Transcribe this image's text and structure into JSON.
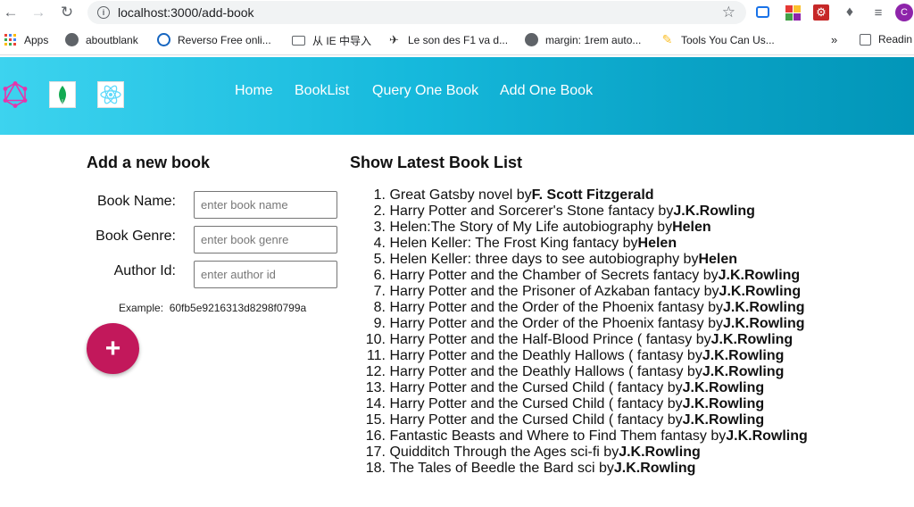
{
  "browser": {
    "url": "localhost:3000/add-book",
    "bookmarks": [
      {
        "label": "Apps"
      },
      {
        "label": "aboutblank"
      },
      {
        "label": "Reverso  Free onli..."
      },
      {
        "label": "从 IE 中导入"
      },
      {
        "label": "Le son des F1 va d..."
      },
      {
        "label": "margin: 1rem auto..."
      },
      {
        "label": "Tools You Can Us..."
      },
      {
        "label": "»"
      },
      {
        "label": "Readin"
      }
    ],
    "profile_initial": "C"
  },
  "nav": {
    "links": [
      "Home",
      "BookList",
      "Query One Book",
      "Add One Book"
    ]
  },
  "form": {
    "title": "Add a new book",
    "fields": [
      {
        "label": "Book Name:",
        "placeholder": "enter book name",
        "value": ""
      },
      {
        "label": "Book Genre:",
        "placeholder": "enter book genre",
        "value": ""
      },
      {
        "label": "Author Id:",
        "placeholder": "enter author id",
        "value": ""
      }
    ],
    "example_label": "Example:",
    "example_value": "60fb5e9216313d8298f0799a",
    "add_button": "+"
  },
  "book_list": {
    "title": "Show Latest Book List",
    "books": [
      {
        "n": "1.",
        "text": "Great Gatsby novel by ",
        "author": "F. Scott Fitzgerald"
      },
      {
        "n": "2.",
        "text": "Harry Potter and Sorcerer's Stone fantacy by ",
        "author": "J.K.Rowling"
      },
      {
        "n": "3.",
        "text": "Helen:The Story of My Life autobiography by ",
        "author": "Helen"
      },
      {
        "n": "4.",
        "text": "Helen Keller: The Frost King fantacy by ",
        "author": "Helen"
      },
      {
        "n": "5.",
        "text": "Helen Keller: three days to see autobiography by ",
        "author": "Helen"
      },
      {
        "n": "6.",
        "text": "Harry Potter and the Chamber of Secrets fantacy by ",
        "author": "J.K.Rowling"
      },
      {
        "n": "7.",
        "text": "Harry Potter and the Prisoner of Azkaban fantacy by ",
        "author": "J.K.Rowling"
      },
      {
        "n": "8.",
        "text": "Harry Potter and the Order of the Phoenix fantasy by ",
        "author": "J.K.Rowling"
      },
      {
        "n": "9.",
        "text": "Harry Potter and the Order of the Phoenix fantasy by ",
        "author": "J.K.Rowling"
      },
      {
        "n": "10.",
        "text": "Harry Potter and the Half-Blood Prince ( fantasy by ",
        "author": "J.K.Rowling"
      },
      {
        "n": "11.",
        "text": "Harry Potter and the Deathly Hallows ( fantasy by ",
        "author": "J.K.Rowling"
      },
      {
        "n": "12.",
        "text": "Harry Potter and the Deathly Hallows ( fantasy by ",
        "author": "J.K.Rowling"
      },
      {
        "n": "13.",
        "text": "Harry Potter and the Cursed Child ( fantacy by ",
        "author": "J.K.Rowling"
      },
      {
        "n": "14.",
        "text": "Harry Potter and the Cursed Child ( fantacy by ",
        "author": "J.K.Rowling"
      },
      {
        "n": "15.",
        "text": "Harry Potter and the Cursed Child ( fantacy by ",
        "author": "J.K.Rowling"
      },
      {
        "n": "16.",
        "text": "Fantastic Beasts and Where to Find Them fantasy by ",
        "author": "J.K.Rowling"
      },
      {
        "n": "17.",
        "text": "Quidditch Through the Ages sci-fi by ",
        "author": "J.K.Rowling"
      },
      {
        "n": "18.",
        "text": "The Tales of Beedle the Bard sci by ",
        "author": "J.K.Rowling"
      }
    ]
  }
}
